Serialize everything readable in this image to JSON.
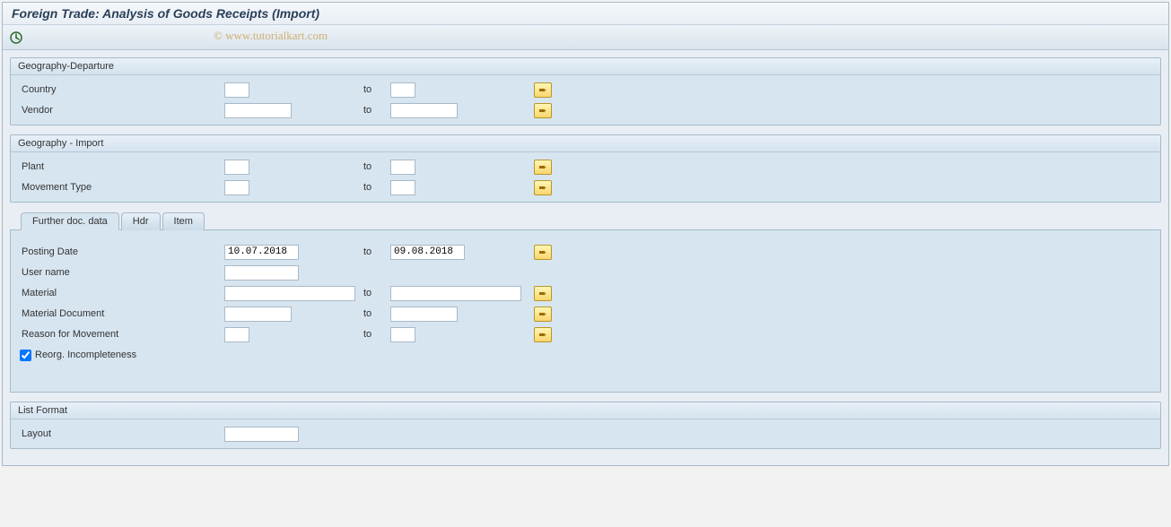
{
  "title": "Foreign Trade: Analysis of Goods Receipts (Import)",
  "watermark": "© www.tutorialkart.com",
  "labels": {
    "to": "to"
  },
  "groups": {
    "departure": {
      "title": "Geography-Departure",
      "country": {
        "label": "Country",
        "from": "",
        "to": ""
      },
      "vendor": {
        "label": "Vendor",
        "from": "",
        "to": ""
      }
    },
    "import": {
      "title": "Geography - Import",
      "plant": {
        "label": "Plant",
        "from": "",
        "to": ""
      },
      "movement": {
        "label": "Movement Type",
        "from": "",
        "to": ""
      }
    }
  },
  "tabs": {
    "further": "Further doc. data",
    "hdr": "Hdr",
    "item": "Item"
  },
  "further": {
    "posting_date": {
      "label": "Posting Date",
      "from": "10.07.2018",
      "to": "09.08.2018"
    },
    "user_name": {
      "label": "User name",
      "value": ""
    },
    "material": {
      "label": "Material",
      "from": "",
      "to": ""
    },
    "material_doc": {
      "label": "Material Document",
      "from": "",
      "to": ""
    },
    "reason_movement": {
      "label": "Reason for Movement",
      "from": "",
      "to": ""
    },
    "reorg_incomplete": {
      "label": "Reorg. Incompleteness",
      "checked": true
    }
  },
  "list_format": {
    "title": "List Format",
    "layout": {
      "label": "Layout",
      "value": ""
    }
  }
}
